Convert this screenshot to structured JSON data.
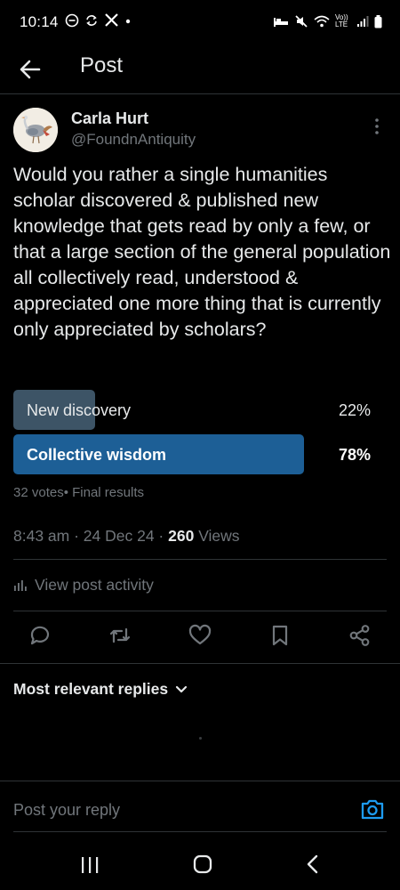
{
  "status_bar": {
    "time": "10:14",
    "left_icons": [
      "minus-circle-icon",
      "sync-icon",
      "x-logo-icon",
      "dot-icon"
    ],
    "right_icons": [
      "bed-icon",
      "mute-icon",
      "wifi-icon",
      "volte-icon",
      "signal-icon",
      "battery-icon"
    ],
    "volte_label": "Vo)) LTE"
  },
  "header": {
    "title": "Post"
  },
  "post": {
    "author_name": "Carla Hurt",
    "author_handle": "@FoundnAntiquity",
    "text": "Would you rather a single humanities scholar discovered & published new knowledge that gets read by only a few, or that a large section of the general population all collectively read, understood & appreciated one more thing that is currently only appreciated by scholars?",
    "poll": {
      "options": [
        {
          "label": "New discovery",
          "percent_text": "22%",
          "share": 0.22
        },
        {
          "label": "Collective wisdom",
          "percent_text": "78%",
          "share": 0.78,
          "winner": true
        }
      ],
      "meta": "32 votes• Final results"
    },
    "timestamp_prefix": "8:43 am · 24 Dec 24 · ",
    "views_count": "260",
    "views_suffix": " Views",
    "activity_label": "View post activity"
  },
  "replies": {
    "sort_label": "Most relevant replies"
  },
  "composer": {
    "placeholder": "Post your reply"
  },
  "colors": {
    "background": "#000000",
    "text": "#e7e9ea",
    "muted": "#71767b",
    "divider": "#2f3336",
    "accent": "#1d9bf0",
    "winner_bar": "#1d5f96",
    "loser_bar": "#3d5466"
  }
}
